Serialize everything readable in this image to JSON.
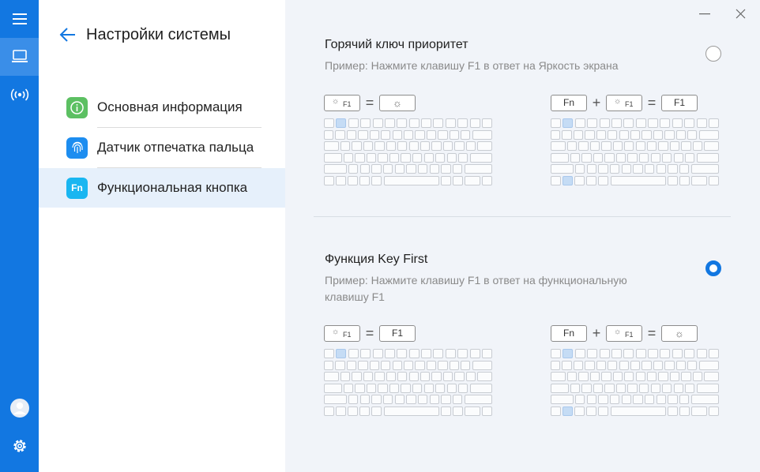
{
  "rail": {
    "items": [
      {
        "icon": "menu-icon"
      },
      {
        "icon": "laptop-icon",
        "active": true
      },
      {
        "icon": "broadcast-icon"
      }
    ],
    "bottom": [
      {
        "icon": "avatar"
      },
      {
        "icon": "gear-icon"
      }
    ]
  },
  "nav": {
    "title": "Настройки системы",
    "items": [
      {
        "label": "Основная информация",
        "icon": "info-icon",
        "icon_color": "#5cc062"
      },
      {
        "label": "Датчик отпечатка пальца",
        "icon": "fingerprint-icon",
        "icon_color": "#1d8df0"
      },
      {
        "label": "Функциональная кнопка",
        "icon": "fn-icon",
        "icon_text": "Fn",
        "icon_color": "#19b6f1",
        "selected": true
      }
    ]
  },
  "content": {
    "options": [
      {
        "title": "Горячий ключ приоритет",
        "description": "Пример: Нажмите клавишу F1 в ответ на Яркость экрана",
        "selected": false,
        "left_equation": {
          "key": "F1",
          "result": "brightness-icon"
        },
        "right_equation": {
          "modifier": "Fn",
          "key": "F1",
          "result": "F1"
        }
      },
      {
        "title": "Функция Key First",
        "description": "Пример: Нажмите клавишу F1 в ответ на функциональную клавишу F1",
        "selected": true,
        "left_equation": {
          "key": "F1",
          "result": "F1"
        },
        "right_equation": {
          "modifier": "Fn",
          "key": "F1",
          "result": "brightness-icon"
        }
      }
    ],
    "symbols": {
      "equals": "=",
      "plus": "+"
    }
  },
  "colors": {
    "accent": "#1277e1",
    "selected_nav": "#e6f0fb",
    "content_bg": "#f1f4f9",
    "key_highlight": "#c5dcf5"
  }
}
